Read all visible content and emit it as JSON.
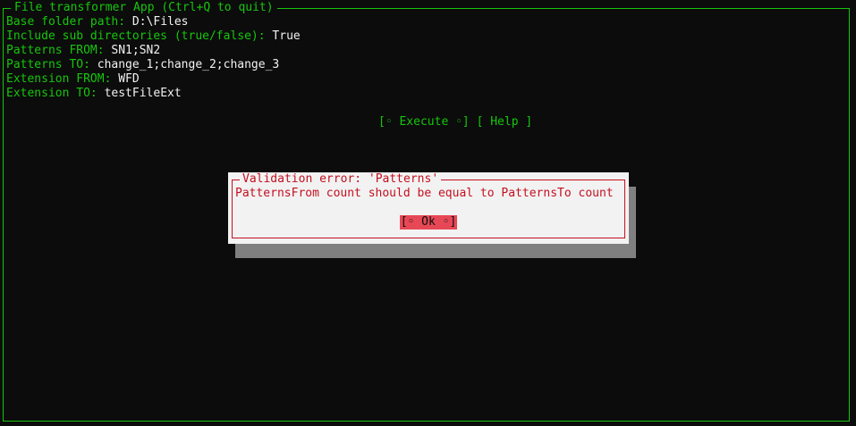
{
  "window": {
    "title": "File transformer App (Ctrl+Q to quit)"
  },
  "form": {
    "fields": [
      {
        "label": "Base folder path:",
        "value": "D:\\Files"
      },
      {
        "label": "Include sub directories (true/false):",
        "value": "True"
      },
      {
        "label": "Patterns FROM:",
        "value": "SN1;SN2"
      },
      {
        "label": "Patterns TO:",
        "value": "change_1;change_2;change_3"
      },
      {
        "label": "Extension FROM:",
        "value": "WFD"
      },
      {
        "label": "Extension TO:",
        "value": "testFileExt"
      }
    ]
  },
  "buttons": {
    "execute_label": "[◦ Execute ◦]",
    "help_label": "[ Help ]"
  },
  "dialog": {
    "title": "Validation error: 'Patterns'",
    "message": "PatternsFrom count should be equal to PatternsTo count",
    "ok_label": "[◦ Ok ◦]"
  },
  "colors": {
    "accent_green": "#16c60c",
    "error_red": "#c50f1f",
    "focus_red": "#e74856"
  }
}
